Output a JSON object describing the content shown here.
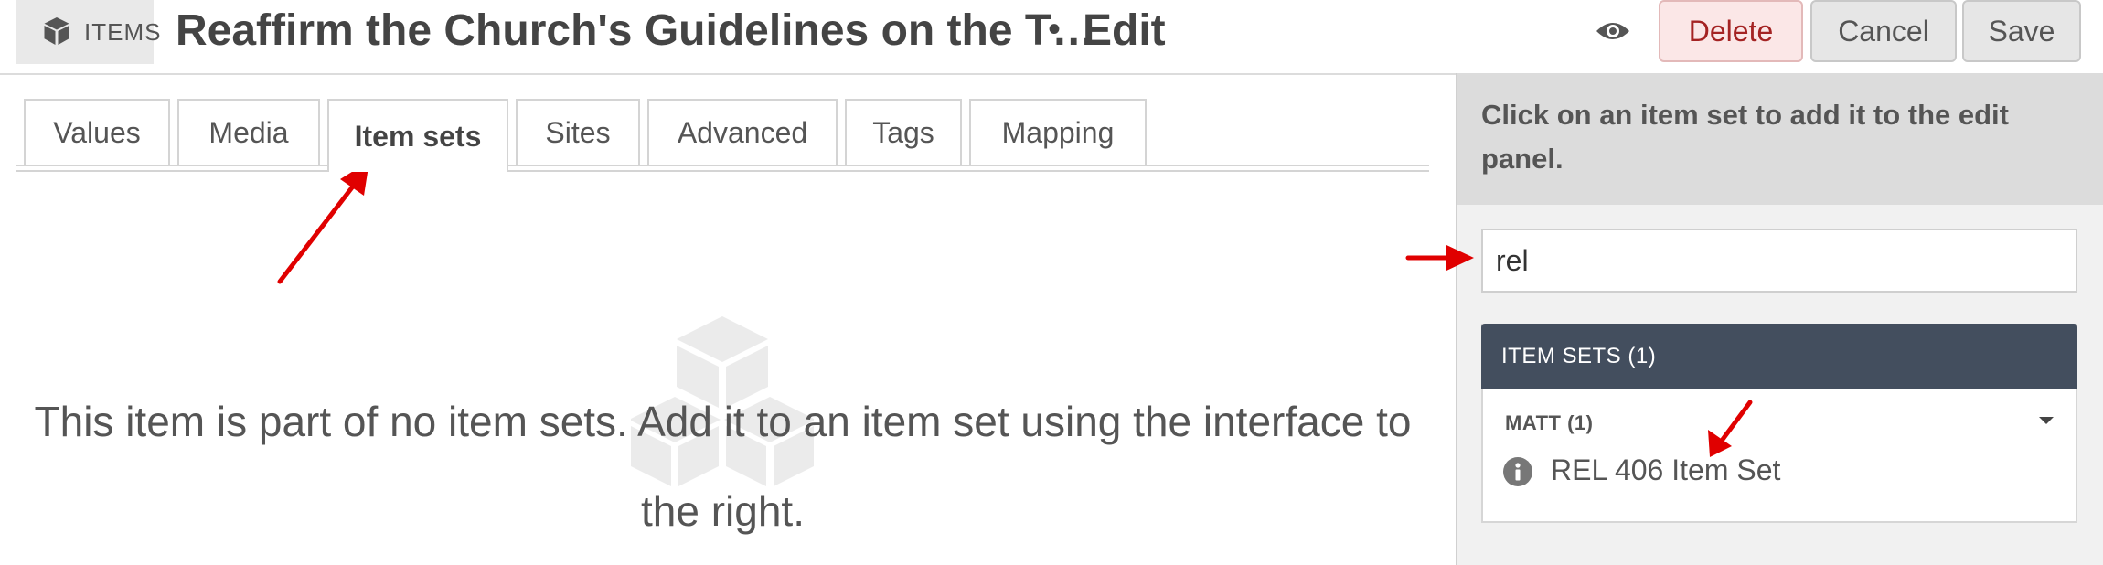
{
  "header": {
    "section_label": "ITEMS",
    "section_icon": "cube-icon",
    "title": "Reaffirm the Church's Guidelines on the T…",
    "separator": "•",
    "mode": "Edit",
    "view_icon": "eye-icon",
    "buttons": {
      "delete": "Delete",
      "cancel": "Cancel",
      "save": "Save"
    }
  },
  "tabs": [
    {
      "label": "Values"
    },
    {
      "label": "Media"
    },
    {
      "label": "Item sets",
      "active": true
    },
    {
      "label": "Sites"
    },
    {
      "label": "Advanced"
    },
    {
      "label": "Tags"
    },
    {
      "label": "Mapping"
    }
  ],
  "main": {
    "empty_message": "This item is part of no item sets. Add it to an item set using the interface to the right.",
    "empty_icon": "item-sets-icon"
  },
  "sidebar": {
    "help_text": "Click on an item set to add it to the edit panel.",
    "search": {
      "value": "rel"
    },
    "results_header": "ITEM SETS (1)",
    "groups": [
      {
        "owner": "MATT (1)",
        "items": [
          {
            "name": "REL 406 Item Set",
            "icon": "info-icon"
          }
        ]
      }
    ]
  },
  "colors": {
    "accent_header": "#434e5e",
    "delete_text": "#a42323",
    "annotation_arrow": "#e00000"
  }
}
